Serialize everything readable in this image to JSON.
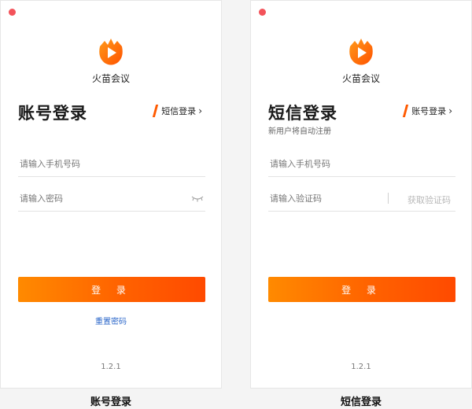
{
  "app_name": "火苗会议",
  "version": "1.2.1",
  "colors": {
    "accent": "#ff6200",
    "link": "#2a66c9",
    "close_dot": "#f3535a"
  },
  "account_login": {
    "title": "账号登录",
    "switch_label": "短信登录",
    "phone_placeholder": "请输入手机号码",
    "password_placeholder": "请输入密码",
    "login_button": "登 录",
    "reset_link": "重置密码",
    "caption": "账号登录"
  },
  "sms_login": {
    "title": "短信登录",
    "switch_label": "账号登录",
    "subtitle": "新用户将自动注册",
    "phone_placeholder": "请输入手机号码",
    "code_placeholder": "请输入验证码",
    "get_code_button": "获取验证码",
    "login_button": "登 录",
    "caption": "短信登录"
  },
  "icons": {
    "close": "close-dot-icon",
    "logo": "flame-play-logo-icon",
    "eye": "eye-closed-icon",
    "chevron": "chevron-right-icon"
  }
}
